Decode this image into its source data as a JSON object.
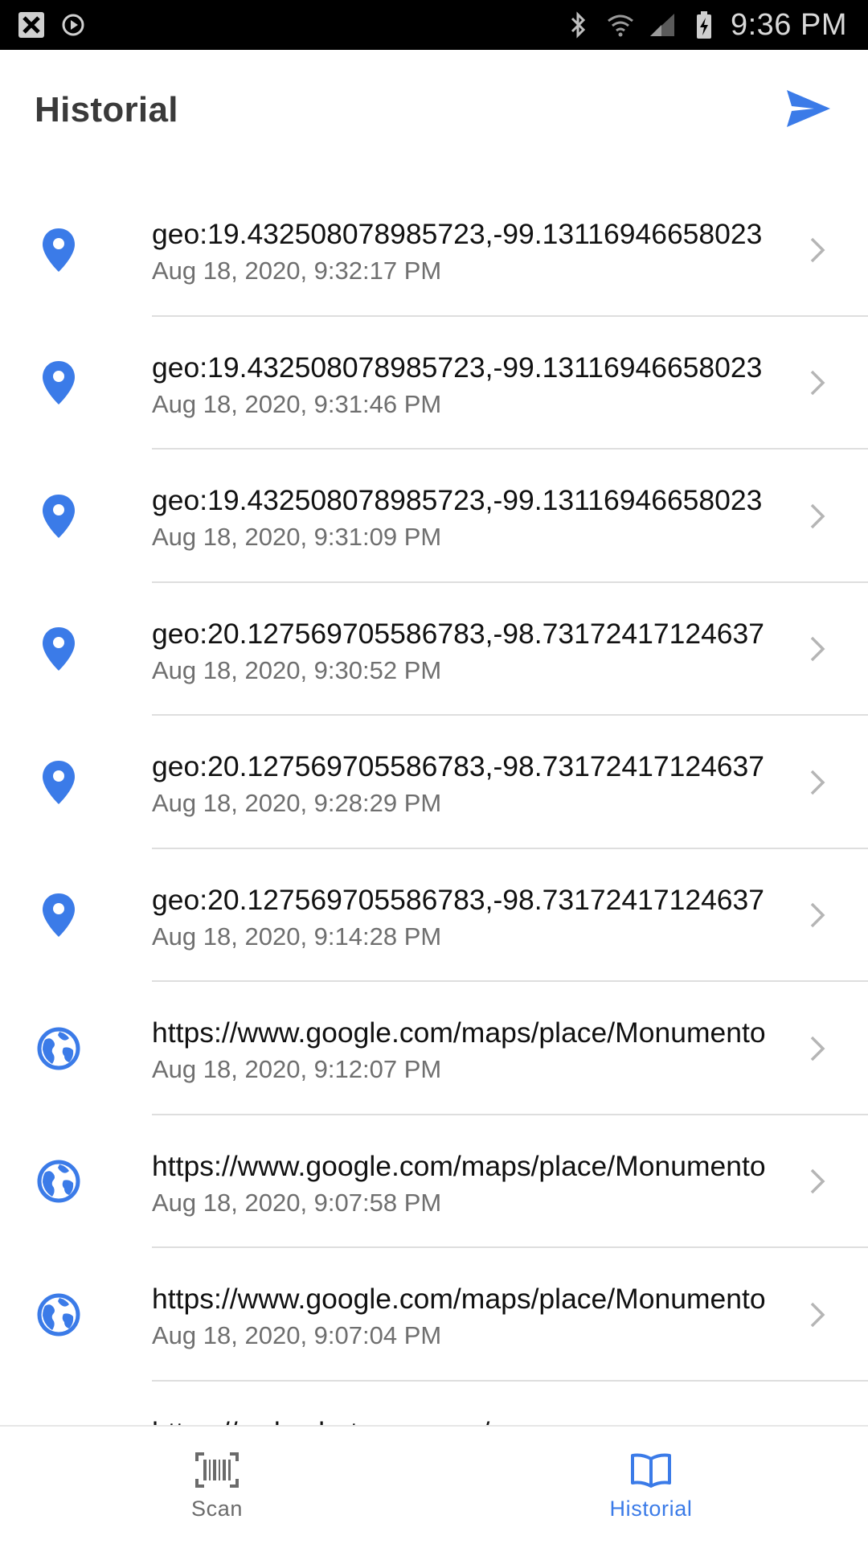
{
  "status_bar": {
    "time": "9:36 PM",
    "left_icons": [
      "notification-x-icon",
      "media-play-icon"
    ],
    "right_icons": [
      "bluetooth-icon",
      "wifi-icon",
      "signal-icon",
      "battery-charging-icon"
    ]
  },
  "app_bar": {
    "title": "Historial",
    "action_icon": "send-icon"
  },
  "colors": {
    "accent": "#3b7be8",
    "status_bar_bg": "#000000",
    "title_text": "#3a3a3a",
    "secondary_text": "#6f6f6f",
    "divider": "#dedede"
  },
  "history": [
    {
      "type": "geo",
      "icon": "location-pin-icon",
      "value": "geo:19.432508078985723,-99.13116946658023",
      "date": "Aug 18, 2020, 9:32:17 PM"
    },
    {
      "type": "geo",
      "icon": "location-pin-icon",
      "value": "geo:19.432508078985723,-99.13116946658023",
      "date": "Aug 18, 2020, 9:31:46 PM"
    },
    {
      "type": "geo",
      "icon": "location-pin-icon",
      "value": "geo:19.432508078985723,-99.13116946658023",
      "date": "Aug 18, 2020, 9:31:09 PM"
    },
    {
      "type": "geo",
      "icon": "location-pin-icon",
      "value": "geo:20.127569705586783,-98.73172417124637",
      "date": "Aug 18, 2020, 9:30:52 PM"
    },
    {
      "type": "geo",
      "icon": "location-pin-icon",
      "value": "geo:20.127569705586783,-98.73172417124637",
      "date": "Aug 18, 2020, 9:28:29 PM"
    },
    {
      "type": "geo",
      "icon": "location-pin-icon",
      "value": "geo:20.127569705586783,-98.73172417124637",
      "date": "Aug 18, 2020, 9:14:28 PM"
    },
    {
      "type": "url",
      "icon": "globe-icon",
      "value": "https://www.google.com/maps/place/Monumento",
      "date": "Aug 18, 2020, 9:12:07 PM"
    },
    {
      "type": "url",
      "icon": "globe-icon",
      "value": "https://www.google.com/maps/place/Monumento",
      "date": "Aug 18, 2020, 9:07:58 PM"
    },
    {
      "type": "url",
      "icon": "globe-icon",
      "value": "https://www.google.com/maps/place/Monumento",
      "date": "Aug 18, 2020, 9:07:04 PM"
    },
    {
      "type": "url",
      "icon": "globe-icon",
      "value": "https://web.whatsapp.com/",
      "date": ""
    }
  ],
  "bottom_nav": {
    "tabs": [
      {
        "label": "Scan",
        "icon": "barcode-icon",
        "active": false
      },
      {
        "label": "Historial",
        "icon": "book-icon",
        "active": true
      }
    ]
  }
}
